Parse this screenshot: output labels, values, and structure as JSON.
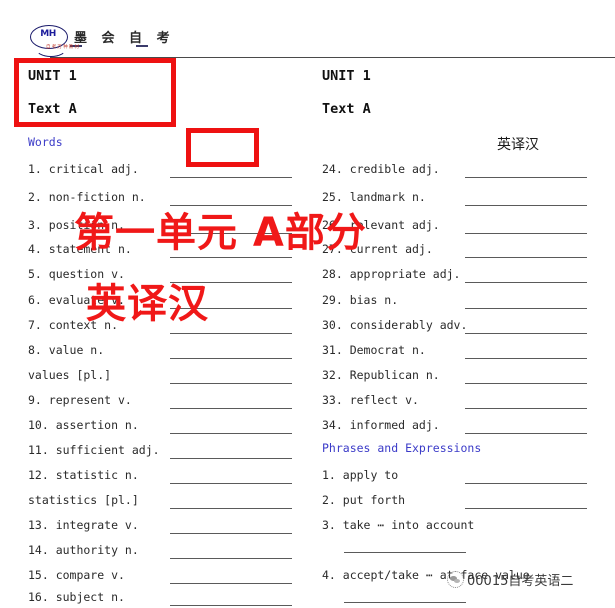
{
  "logo": {
    "mark_text": "MH",
    "brand_cn": "墨 会 自 考",
    "tagline": "自考万种教材"
  },
  "left_column": {
    "unit": "UNIT 1",
    "text": "Text A",
    "section_heading": "Words",
    "cn_heading": "英译汉",
    "entries": [
      {
        "label": "1.  critical adj."
      },
      {
        "label": "2.  non-fiction n."
      },
      {
        "label": "3.  position n."
      },
      {
        "label": "4.  statement n."
      },
      {
        "label": "5.  question v."
      },
      {
        "label": "6.  evaluate v."
      },
      {
        "label": "7.  context n."
      },
      {
        "label": "8.  value n."
      },
      {
        "label": "values [pl.]"
      },
      {
        "label": "9.  represent v."
      },
      {
        "label": "10. assertion n."
      },
      {
        "label": "11. sufficient adj."
      },
      {
        "label": "12. statistic n."
      },
      {
        "label": "statistics [pl.]"
      },
      {
        "label": "13. integrate v."
      },
      {
        "label": "14. authority n."
      },
      {
        "label": "15. compare v."
      },
      {
        "label": "16. subject n."
      }
    ]
  },
  "right_column": {
    "unit": "UNIT 1",
    "text": "Text A",
    "cn_heading": "英译汉",
    "entries": [
      {
        "label": "24. credible adj."
      },
      {
        "label": "25. landmark n."
      },
      {
        "label": "26. relevant adj."
      },
      {
        "label": "27. current adj."
      },
      {
        "label": "28. appropriate adj."
      },
      {
        "label": "29. bias n."
      },
      {
        "label": "30. considerably adv."
      },
      {
        "label": "31. Democrat n."
      },
      {
        "label": "32. Republican n."
      },
      {
        "label": "33. reflect v."
      },
      {
        "label": "34. informed adj."
      }
    ],
    "phrases_heading": "Phrases and Expressions",
    "phrases": [
      {
        "label": "1.  apply to",
        "wrap": false
      },
      {
        "label": "2.  put forth",
        "wrap": false
      },
      {
        "label": "3.  take ⋯ into account",
        "wrap": true
      },
      {
        "label": "4.  accept/take ⋯ at face value",
        "wrap": true
      }
    ]
  },
  "annotations": {
    "overlay_line1": "第一单元 A部分",
    "overlay_line2": "英译汉",
    "box_color": "#ee1111",
    "overlay_color": "#f01818"
  },
  "watermark": {
    "text": "00015自考英语二"
  }
}
